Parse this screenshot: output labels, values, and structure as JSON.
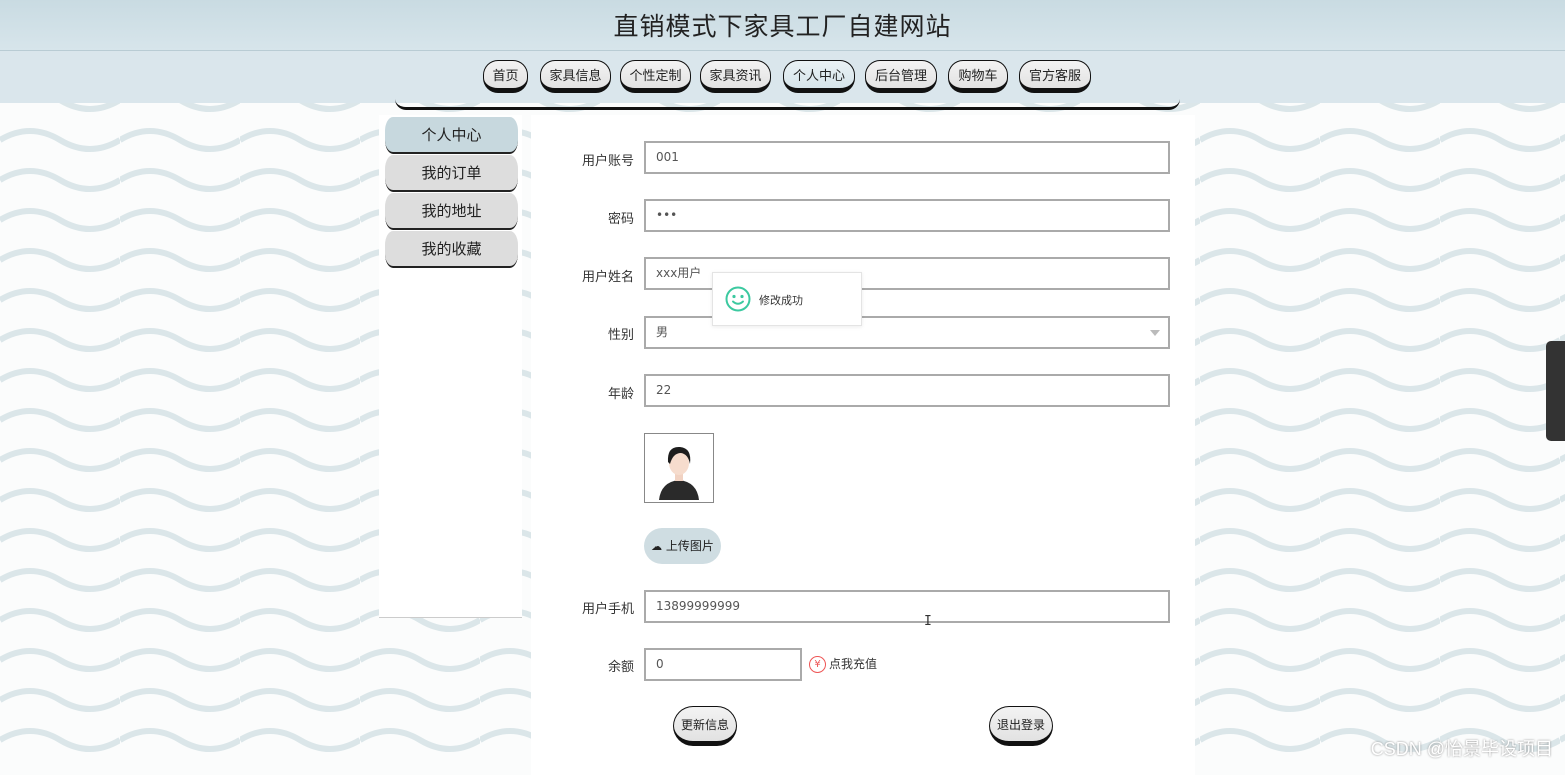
{
  "header": {
    "title": "直销模式下家具工厂自建网站"
  },
  "nav": {
    "items": [
      {
        "label": "首页"
      },
      {
        "label": "家具信息"
      },
      {
        "label": "个性定制"
      },
      {
        "label": "家具资讯"
      },
      {
        "label": "个人中心"
      },
      {
        "label": "后台管理"
      },
      {
        "label": "购物车"
      },
      {
        "label": "官方客服"
      }
    ],
    "active": "个人中心"
  },
  "sidebar": {
    "items": [
      {
        "label": "个人中心"
      },
      {
        "label": "我的订单"
      },
      {
        "label": "我的地址"
      },
      {
        "label": "我的收藏"
      }
    ],
    "active": "个人中心"
  },
  "form": {
    "account": {
      "label": "用户账号",
      "value": "001"
    },
    "password": {
      "label": "密码",
      "value": "•••"
    },
    "name": {
      "label": "用户姓名",
      "value": "xxx用户"
    },
    "gender": {
      "label": "性别",
      "value": "男"
    },
    "age": {
      "label": "年龄",
      "value": "22"
    },
    "upload_label": "上传图片",
    "phone": {
      "label": "用户手机",
      "value": "13899999999"
    },
    "balance": {
      "label": "余额",
      "value": "0"
    },
    "recharge_label": "点我充值",
    "recharge_icon_text": "¥",
    "update_button": "更新信息",
    "logout_button": "退出登录"
  },
  "toast": {
    "message": "修改成功",
    "icon": "smile-icon"
  },
  "watermark": "CSDN @怡景毕设项目",
  "colors": {
    "header_bg": "#c9dbe2",
    "nav_bg": "#dae6ec",
    "accent": "#c7d8de",
    "toast_icon": "#3cc9a0",
    "recharge": "#e55555"
  }
}
